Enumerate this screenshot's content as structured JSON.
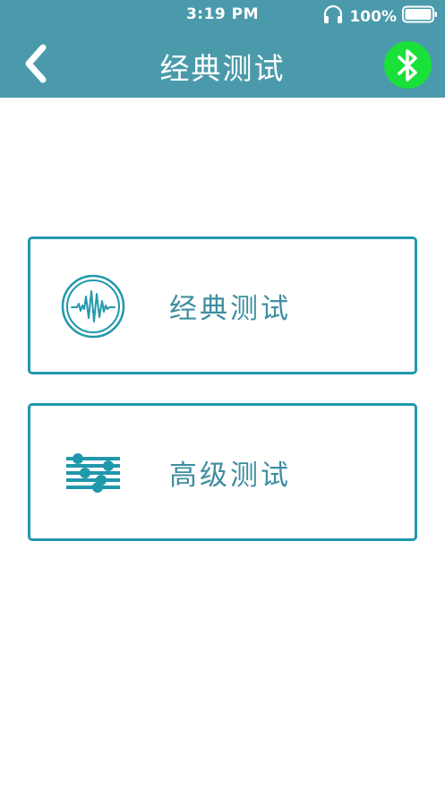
{
  "status_bar": {
    "time": "3:19 PM",
    "battery": "100%"
  },
  "nav": {
    "title": "经典测试",
    "back_icon": "chevron-left-icon",
    "bluetooth_icon": "bluetooth-icon"
  },
  "options": [
    {
      "label": "经典测试",
      "icon": "waveform-icon"
    },
    {
      "label": "高级测试",
      "icon": "equalizer-sliders-icon"
    }
  ],
  "colors": {
    "header": "#4a9aab",
    "accent": "#2098ac",
    "label_text": "#3f8ea0",
    "bluetooth_bg": "#1ae03a",
    "background": "#ffffff"
  }
}
